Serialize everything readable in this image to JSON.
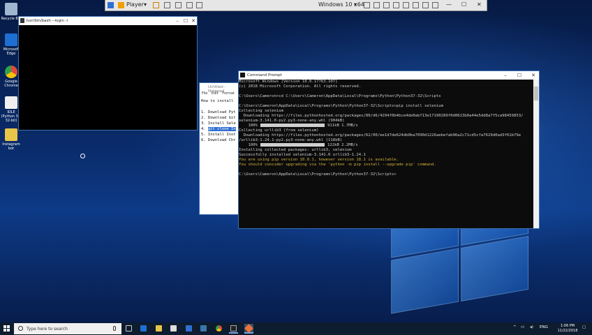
{
  "vm_toolbar": {
    "player_label": "Player",
    "vm_name": "Windows 10 x64"
  },
  "desktop_icons": [
    {
      "label": "Recycle Bin",
      "color": "#9fb7cf"
    },
    {
      "label": "Microsoft Edge",
      "color": "#1e6fd1"
    },
    {
      "label": "Google Chrome",
      "color": "#e04b3a"
    },
    {
      "label": "IDLE (Python 3.7 32-bit)",
      "color": "#f0f0f0"
    },
    {
      "label": "Instagram bot",
      "color": "#e8c44a"
    }
  ],
  "bash_window": {
    "title": "/usr/bin/bash --login -i"
  },
  "notepad_window": {
    "title": "Untitled - Notepad",
    "menu": [
      "File",
      "Edit",
      "Format"
    ],
    "lines": [
      "How to install",
      "",
      "1. Download Pyt",
      "2. Download Git",
      "3. Install Sele",
      "4. git clone In",
      "5. Install Inst",
      "6. Download Chr"
    ]
  },
  "cmd_window": {
    "title": "Command Prompt",
    "lines": [
      "Microsoft Windows [Version 10.0.17763.107]",
      "(c) 2018 Microsoft Corporation. All rights reserved.",
      "",
      "C:\\Users\\Cameron>cd C:\\Users\\Cameron\\AppData\\Local\\Programs\\Python\\Python37-32\\Scripts",
      "",
      "C:\\Users\\Cameron\\AppData\\Local\\Programs\\Python\\Python37-32\\Scripts>pip install selenium",
      "Collecting selenium",
      "  Downloading https://files.pythonhosted.org/packages/80/d6/4294f0b4bce4de0abf13e17190289f0d0613b0a44e5dd8a7f5ca98459853/",
      "selenium-3.141.0-py2.py3-none-any.whl (904kB)",
      "Collecting urllib3 (from selenium)",
      "  Downloading https://files.pythonhosted.org/packages/62/00/ee1d7de624db0ba7090d1226aebefab96a2c71cd5cfa7629d0ad3f61b79e",
      "/urllib3-1.24.1-py2.py3-none-any.whl (118kB)",
      "Installing collected packages: urllib3, selenium",
      "Successfully installed selenium-3.141.0 urllib3-1.24.1",
      "You are using pip version 10.0.1, however version 18.1 is available.",
      "You should consider upgrading via the 'python -m pip install --upgrade pip' command.",
      "",
      "C:\\Users\\Cameron\\AppData\\Local\\Programs\\Python\\Python37-32\\Scripts>"
    ],
    "progress1": {
      "percent": "100%",
      "stats": "911kB 1.7MB/s"
    },
    "progress2": {
      "percent": "100%",
      "stats": "122kB 2.2MB/s"
    }
  },
  "taskbar": {
    "search_placeholder": "Type here to search",
    "language": "ENG",
    "time": "1:06 PM",
    "date": "11/22/2018"
  }
}
